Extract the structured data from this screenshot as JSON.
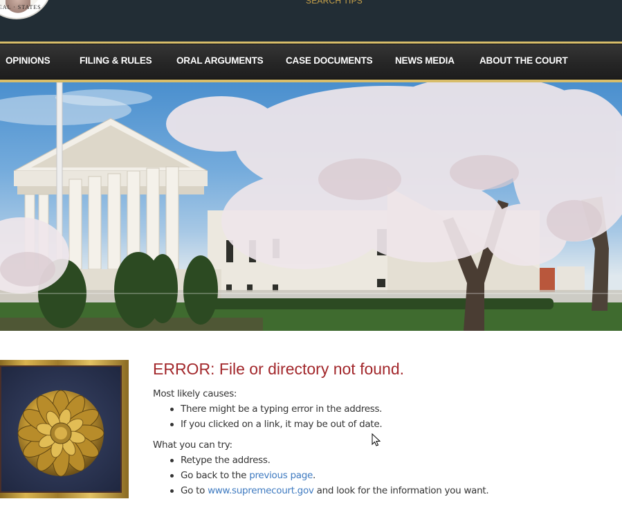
{
  "header": {
    "seal_text": "SEAL · STATES",
    "search_tips": "SEARCH TIPS"
  },
  "nav": {
    "items": [
      {
        "label": "OPINIONS"
      },
      {
        "label": "FILING & RULES"
      },
      {
        "label": "ORAL ARGUMENTS"
      },
      {
        "label": "CASE DOCUMENTS"
      },
      {
        "label": "NEWS MEDIA"
      },
      {
        "label": "ABOUT THE COURT"
      }
    ]
  },
  "hero": {
    "description": "Supreme Court building with cherry blossoms"
  },
  "main": {
    "error_title": "ERROR: File or directory not found.",
    "causes_label": "Most likely causes:",
    "causes": [
      "There might be a typing error in the address.",
      "If you clicked on a link, it may be out of date."
    ],
    "try_label": "What you can try:",
    "try_items": {
      "retype": "Retype the address.",
      "go_back_prefix": "Go back to the ",
      "go_back_link": "previous page",
      "go_back_suffix": ".",
      "goto_prefix": "Go to ",
      "goto_link": "www.supremecourt.gov",
      "goto_suffix": " and look for the information you want."
    }
  },
  "colors": {
    "header_bg": "#222d35",
    "gold": "#d8bd6a",
    "error_red": "#a2272b",
    "link_blue": "#3e7ac0"
  }
}
